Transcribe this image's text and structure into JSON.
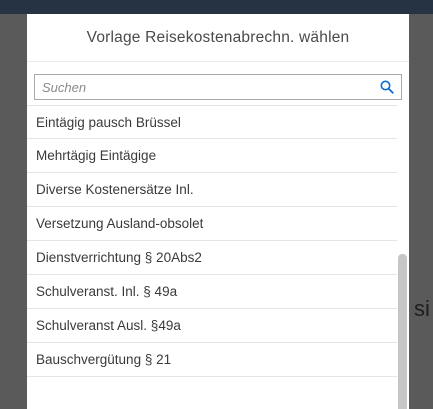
{
  "dialog": {
    "title": "Vorlage Reisekostenabrechn. wählen",
    "search": {
      "placeholder": "Suchen",
      "value": ""
    },
    "items": [
      {
        "label": "Eintägig pausch Brüssel"
      },
      {
        "label": "Mehrtägig Eintägige"
      },
      {
        "label": "Diverse Kostenersätze Inl."
      },
      {
        "label": "Versetzung Ausland-obsolet"
      },
      {
        "label": "Dienstverrichtung § 20Abs2"
      },
      {
        "label": "Schulveranst. Inl. § 49a"
      },
      {
        "label": "Schulveranst Ausl. §49a"
      },
      {
        "label": "Bauschvergütung § 21"
      }
    ]
  },
  "background": {
    "partial_text": "si"
  },
  "icons": {
    "search": "search-icon"
  },
  "colors": {
    "accent": "#0a6ed1",
    "topbar": "#253342",
    "overlay": "#5a5a5a"
  }
}
